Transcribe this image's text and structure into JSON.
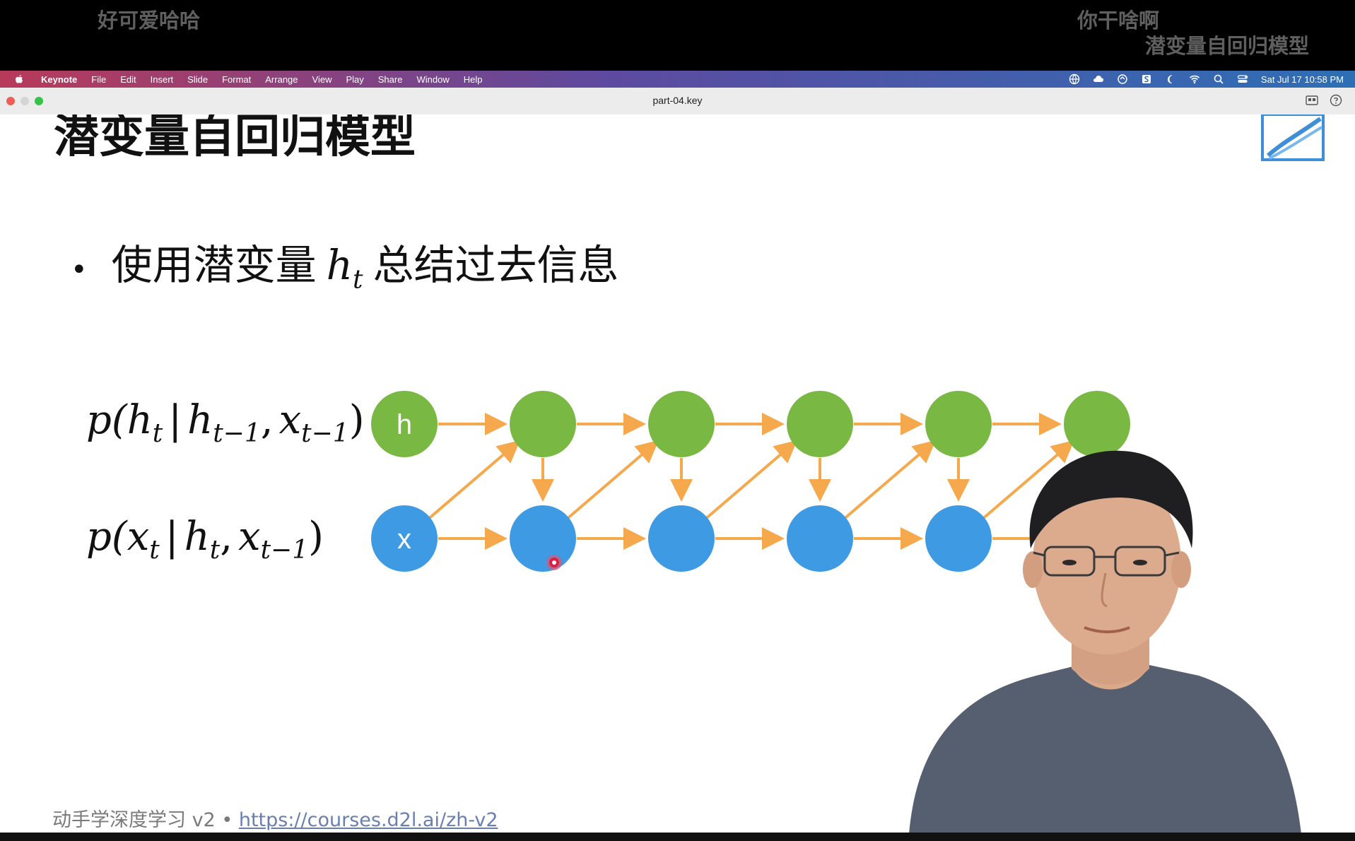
{
  "danmaku": [
    {
      "text": "好可爱哈哈"
    },
    {
      "text": "你干啥啊"
    },
    {
      "text": "潜变量自回归模型"
    }
  ],
  "menubar": {
    "app": "Keynote",
    "items": [
      "File",
      "Edit",
      "Insert",
      "Slide",
      "Format",
      "Arrange",
      "View",
      "Play",
      "Share",
      "Window",
      "Help"
    ],
    "clock": "Sat Jul 17  10:58 PM"
  },
  "window": {
    "title": "part-04.key"
  },
  "slide": {
    "title": "潜变量自回归模型",
    "bullet_prefix": "使用潜变量",
    "bullet_var": "h",
    "bullet_var_sub": "t",
    "bullet_suffix": "总结过去信息",
    "formula1": {
      "f": "p(",
      "v1": "h",
      "s1": "t",
      "bar": "|",
      "v2": "h",
      "s2": "t−1",
      "comma": ",",
      "v3": "x",
      "s3": "t−1",
      "close": ")"
    },
    "formula2": {
      "f": "p(",
      "v1": "x",
      "s1": "t",
      "bar": "|",
      "v2": "h",
      "s2": "t",
      "comma": ",",
      "v3": "x",
      "s3": "t−1",
      "close": ")"
    },
    "node_h_label": "h",
    "node_x_label": "x",
    "colors": {
      "green": "#78b843",
      "blue": "#3e9be3",
      "arrow": "#f5a84c"
    },
    "footer_text": "动手学深度学习 v2 • ",
    "footer_link": "https://courses.d2l.ai/zh-v2"
  }
}
